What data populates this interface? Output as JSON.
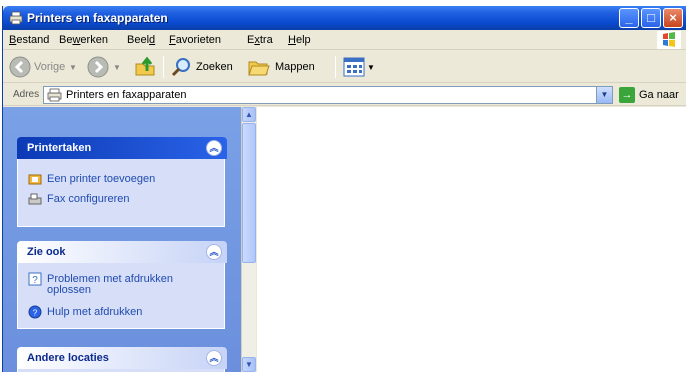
{
  "window": {
    "title": "Printers en faxapparaten",
    "title_icon": "printer-folder-icon",
    "controls": [
      "minimize-icon",
      "maximize-icon",
      "close-icon"
    ]
  },
  "menu": {
    "items": [
      {
        "pre": "",
        "u": "B",
        "post": "estand"
      },
      {
        "pre": "Be",
        "u": "w",
        "post": "erken"
      },
      {
        "pre": "Beel",
        "u": "d",
        "post": ""
      },
      {
        "pre": "",
        "u": "F",
        "post": "avorieten"
      },
      {
        "pre": "E",
        "u": "x",
        "post": "tra"
      },
      {
        "pre": "",
        "u": "H",
        "post": "elp"
      }
    ]
  },
  "toolbar": {
    "back_label": "Vorige",
    "search_label": "Zoeken",
    "folders_label": "Mappen"
  },
  "address": {
    "label": "Adres",
    "value": "Printers en faxapparaten",
    "go_label": "Ga naar"
  },
  "taskpane": {
    "panels": [
      {
        "title": "Printertaken",
        "tasks": [
          {
            "label": "Een printer toevoegen",
            "icon": "add-printer-icon"
          },
          {
            "label": "Fax configureren",
            "icon": "fax-icon"
          }
        ]
      },
      {
        "title": "Zie ook",
        "tasks": [
          {
            "label": "Problemen met afdrukken",
            "label2": "oplossen",
            "icon": "help-question-icon"
          },
          {
            "label": "Hulp met afdrukken",
            "icon": "globe-help-icon"
          }
        ]
      },
      {
        "title": "Andere locaties",
        "tasks": []
      }
    ]
  },
  "colors": {
    "titlebar": "#0a4ad0",
    "taskpane_bg": "#7aa1e6",
    "panel_bg": "#d6dff7",
    "task_link": "#214bb0"
  }
}
